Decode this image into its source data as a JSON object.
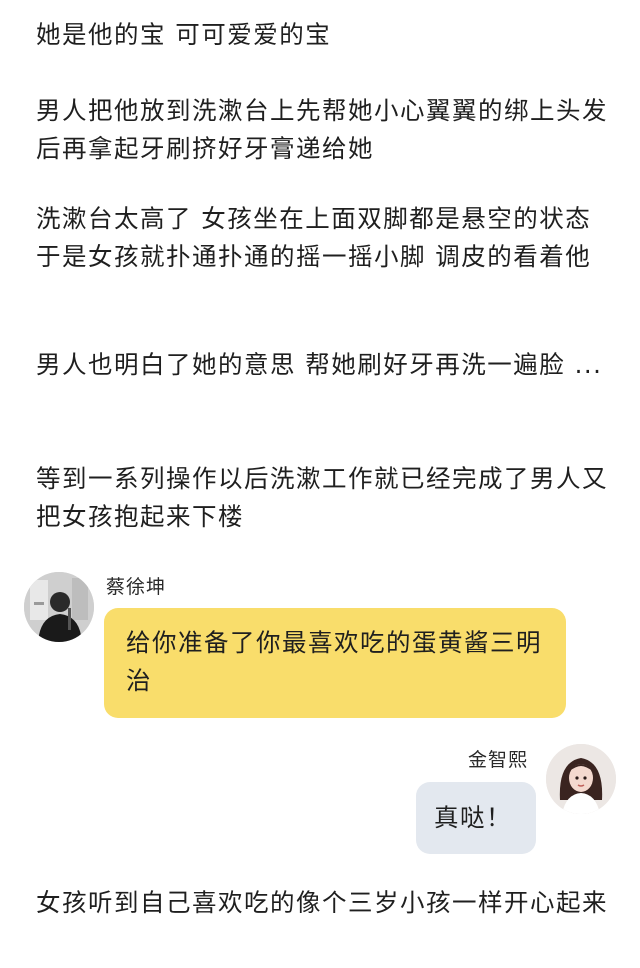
{
  "story": {
    "p1": "她是他的宝 可可爱爱的宝",
    "p2": "男人把他放到洗漱台上先帮她小心翼翼的绑上头发后再拿起牙刷挤好牙膏递给她",
    "p3": "洗漱台太高了 女孩坐在上面双脚都是悬空的状态 于是女孩就扑通扑通的摇一摇小脚 调皮的看着他",
    "p4": "男人也明白了她的意思 帮她刷好牙再洗一遍脸 ...",
    "p5": "等到一系列操作以后洗漱工作就已经完成了男人又把女孩抱起来下楼",
    "p6": "女孩听到自己喜欢吃的像个三岁小孩一样开心起来"
  },
  "chat": {
    "left": {
      "name": "蔡徐坤",
      "message": "给你准备了你最喜欢吃的蛋黄酱三明治",
      "bubble_color": "#f9dd6b"
    },
    "right": {
      "name": "金智熙",
      "message": "真哒！",
      "bubble_color": "#e3e8ef"
    }
  }
}
